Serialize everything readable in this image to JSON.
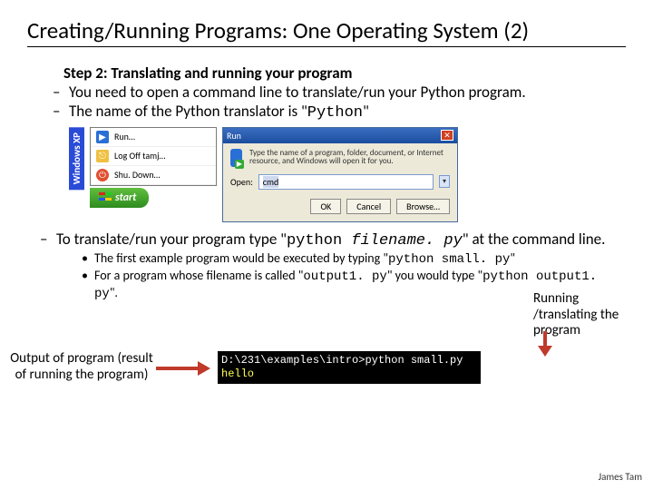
{
  "title": "Creating/Running Programs: One Operating System (2)",
  "step_header": "Step 2: Translating and running your program",
  "bullets": {
    "b1": "You need to open a command line to translate/run your Python program.",
    "b2_pre": "The name of the Python translator is \"",
    "b2_mono": "Python",
    "b2_post": "\"",
    "b3_pre": "To translate/run your program type \"",
    "b3_mono1": "python ",
    "b3_mono2": "filename. py",
    "b3_post": "\" at the command line."
  },
  "subs": {
    "s1_pre": "The first example program would be executed by typing \"",
    "s1_mono": "python small. py",
    "s1_post": "\"",
    "s2_pre": "For a program whose filename is called \"",
    "s2_mono1": "output1. py",
    "s2_mid": "\" you would type \"",
    "s2_mono2": "python output1. py",
    "s2_post": "\"."
  },
  "os_tag": "Windows XP",
  "startmenu": {
    "run": "Run…",
    "logoff": "Log Off tamj…",
    "shutdown": "Shu. Down…",
    "start": "start"
  },
  "run_dialog": {
    "title": "Run",
    "desc": "Type the name of a program, folder, document, or Internet resource, and Windows will open it for you.",
    "open_label": "Open:",
    "value": "cmd",
    "ok": "OK",
    "cancel": "Cancel",
    "browse": "Browse…"
  },
  "annotations": {
    "output": "Output of program (result of running the program)",
    "running": "Running /translating the program"
  },
  "terminal": {
    "prompt": "D:\\231\\examples\\intro>",
    "cmd": "python small.py",
    "output": "hello"
  },
  "author": "James Tam"
}
